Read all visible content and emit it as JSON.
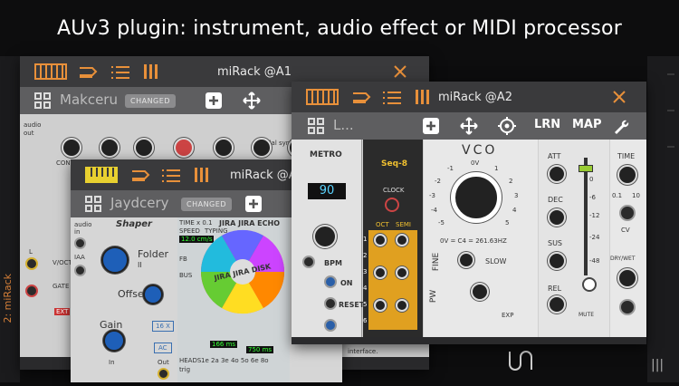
{
  "banner": "AUv3 plugin: instrument, audio effect or MIDI processor",
  "side_label": "2: miRack",
  "win1": {
    "title": "miRack @A1",
    "name": "Makceru",
    "badge": "CHANGED",
    "mod_labels": {
      "modal": "modal synthesizer",
      "audio": "audio",
      "out": "out",
      "l": "L",
      "vdoct": "V/OCT",
      "gate": "GATE",
      "ext": "EXT",
      "mi": "mi",
      "conti": "CONTI"
    }
  },
  "win2": {
    "title": "miRack @A",
    "name": "Jaydcery",
    "badge": "CHANGED",
    "shaper": {
      "title": "Shaper",
      "folder": "Folder",
      "folder_sub": "II",
      "offset": "Offset",
      "gain": "Gain",
      "btn16": "16 X",
      "btnac": "AC",
      "in": "In",
      "out": "Out",
      "audio": "audio",
      "in2": "in",
      "iaa": "IAA"
    },
    "echo": {
      "title": "JIRA JIRA ECHO",
      "disk": "JIRA JIRA DISK",
      "speed": "SPEED",
      "typing": "TYPING",
      "time": "TIME x 0.1",
      "display": "12.0 cm/s",
      "fb": "FB",
      "bus": "BUS",
      "t1": "166 ms",
      "t2": "750 ms",
      "heads": "HEADS",
      "row": "1e 2a 3e 4o 5o 6e 8o",
      "trig": "trig"
    },
    "footer": "interface."
  },
  "win3": {
    "title": "miRack @A2",
    "name": "L...",
    "lrn": "LRN",
    "map": "MAP",
    "metro": {
      "title": "METRO",
      "value": "90",
      "bpm": "BPM",
      "on": "ON",
      "reset": "RESET"
    },
    "seq": {
      "title": "Seq-8",
      "clock": "CLOCK",
      "oct": "OCT",
      "semi": "SEMI",
      "rows": [
        "1",
        "2",
        "3",
        "4",
        "5",
        "6"
      ]
    },
    "vco": {
      "title": "VCO",
      "scale": [
        "0V",
        "1",
        "2",
        "3",
        "4",
        "5",
        "-1",
        "-2",
        "-3",
        "-4",
        "-5"
      ],
      "tune": "0V = C4 = 261.63HZ",
      "fine": "FINE",
      "slow": "SLOW",
      "pw": "PW",
      "exp": "EXP"
    },
    "env": {
      "att": "ATT",
      "dec": "DEC",
      "sus": "SUS",
      "rel": "REL",
      "time": "TIME",
      "dw": "DRY/WET",
      "mute": "MUTE",
      "cv": "CV",
      "range": "0.1",
      "r10": "10",
      "fader": [
        "0",
        "-6",
        "-12",
        "-24",
        "-48"
      ]
    }
  }
}
